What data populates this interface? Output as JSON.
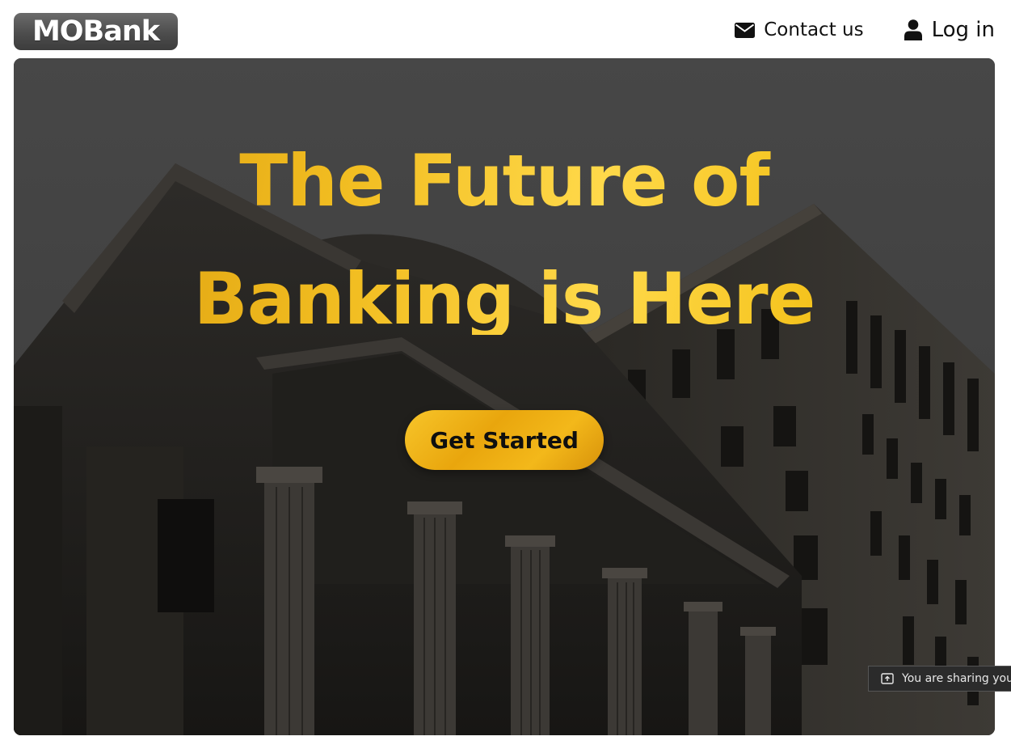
{
  "header": {
    "logo_text": "MOBank",
    "nav": {
      "contact": {
        "label": "Contact us",
        "icon": "envelope-icon"
      },
      "login": {
        "label": "Log in",
        "icon": "user-icon"
      }
    }
  },
  "hero": {
    "headline_line1": "The Future of",
    "headline_line2": "Banking is Here",
    "cta_label": "Get Started",
    "background": "bank-building-photo"
  },
  "screen_share": {
    "text": "You are sharing you",
    "icon": "share-screen-icon"
  },
  "colors": {
    "gold": "#f2be22",
    "gold_dark": "#d99a0a",
    "overlay": "#3a3a3a",
    "text_dark": "#111111"
  }
}
